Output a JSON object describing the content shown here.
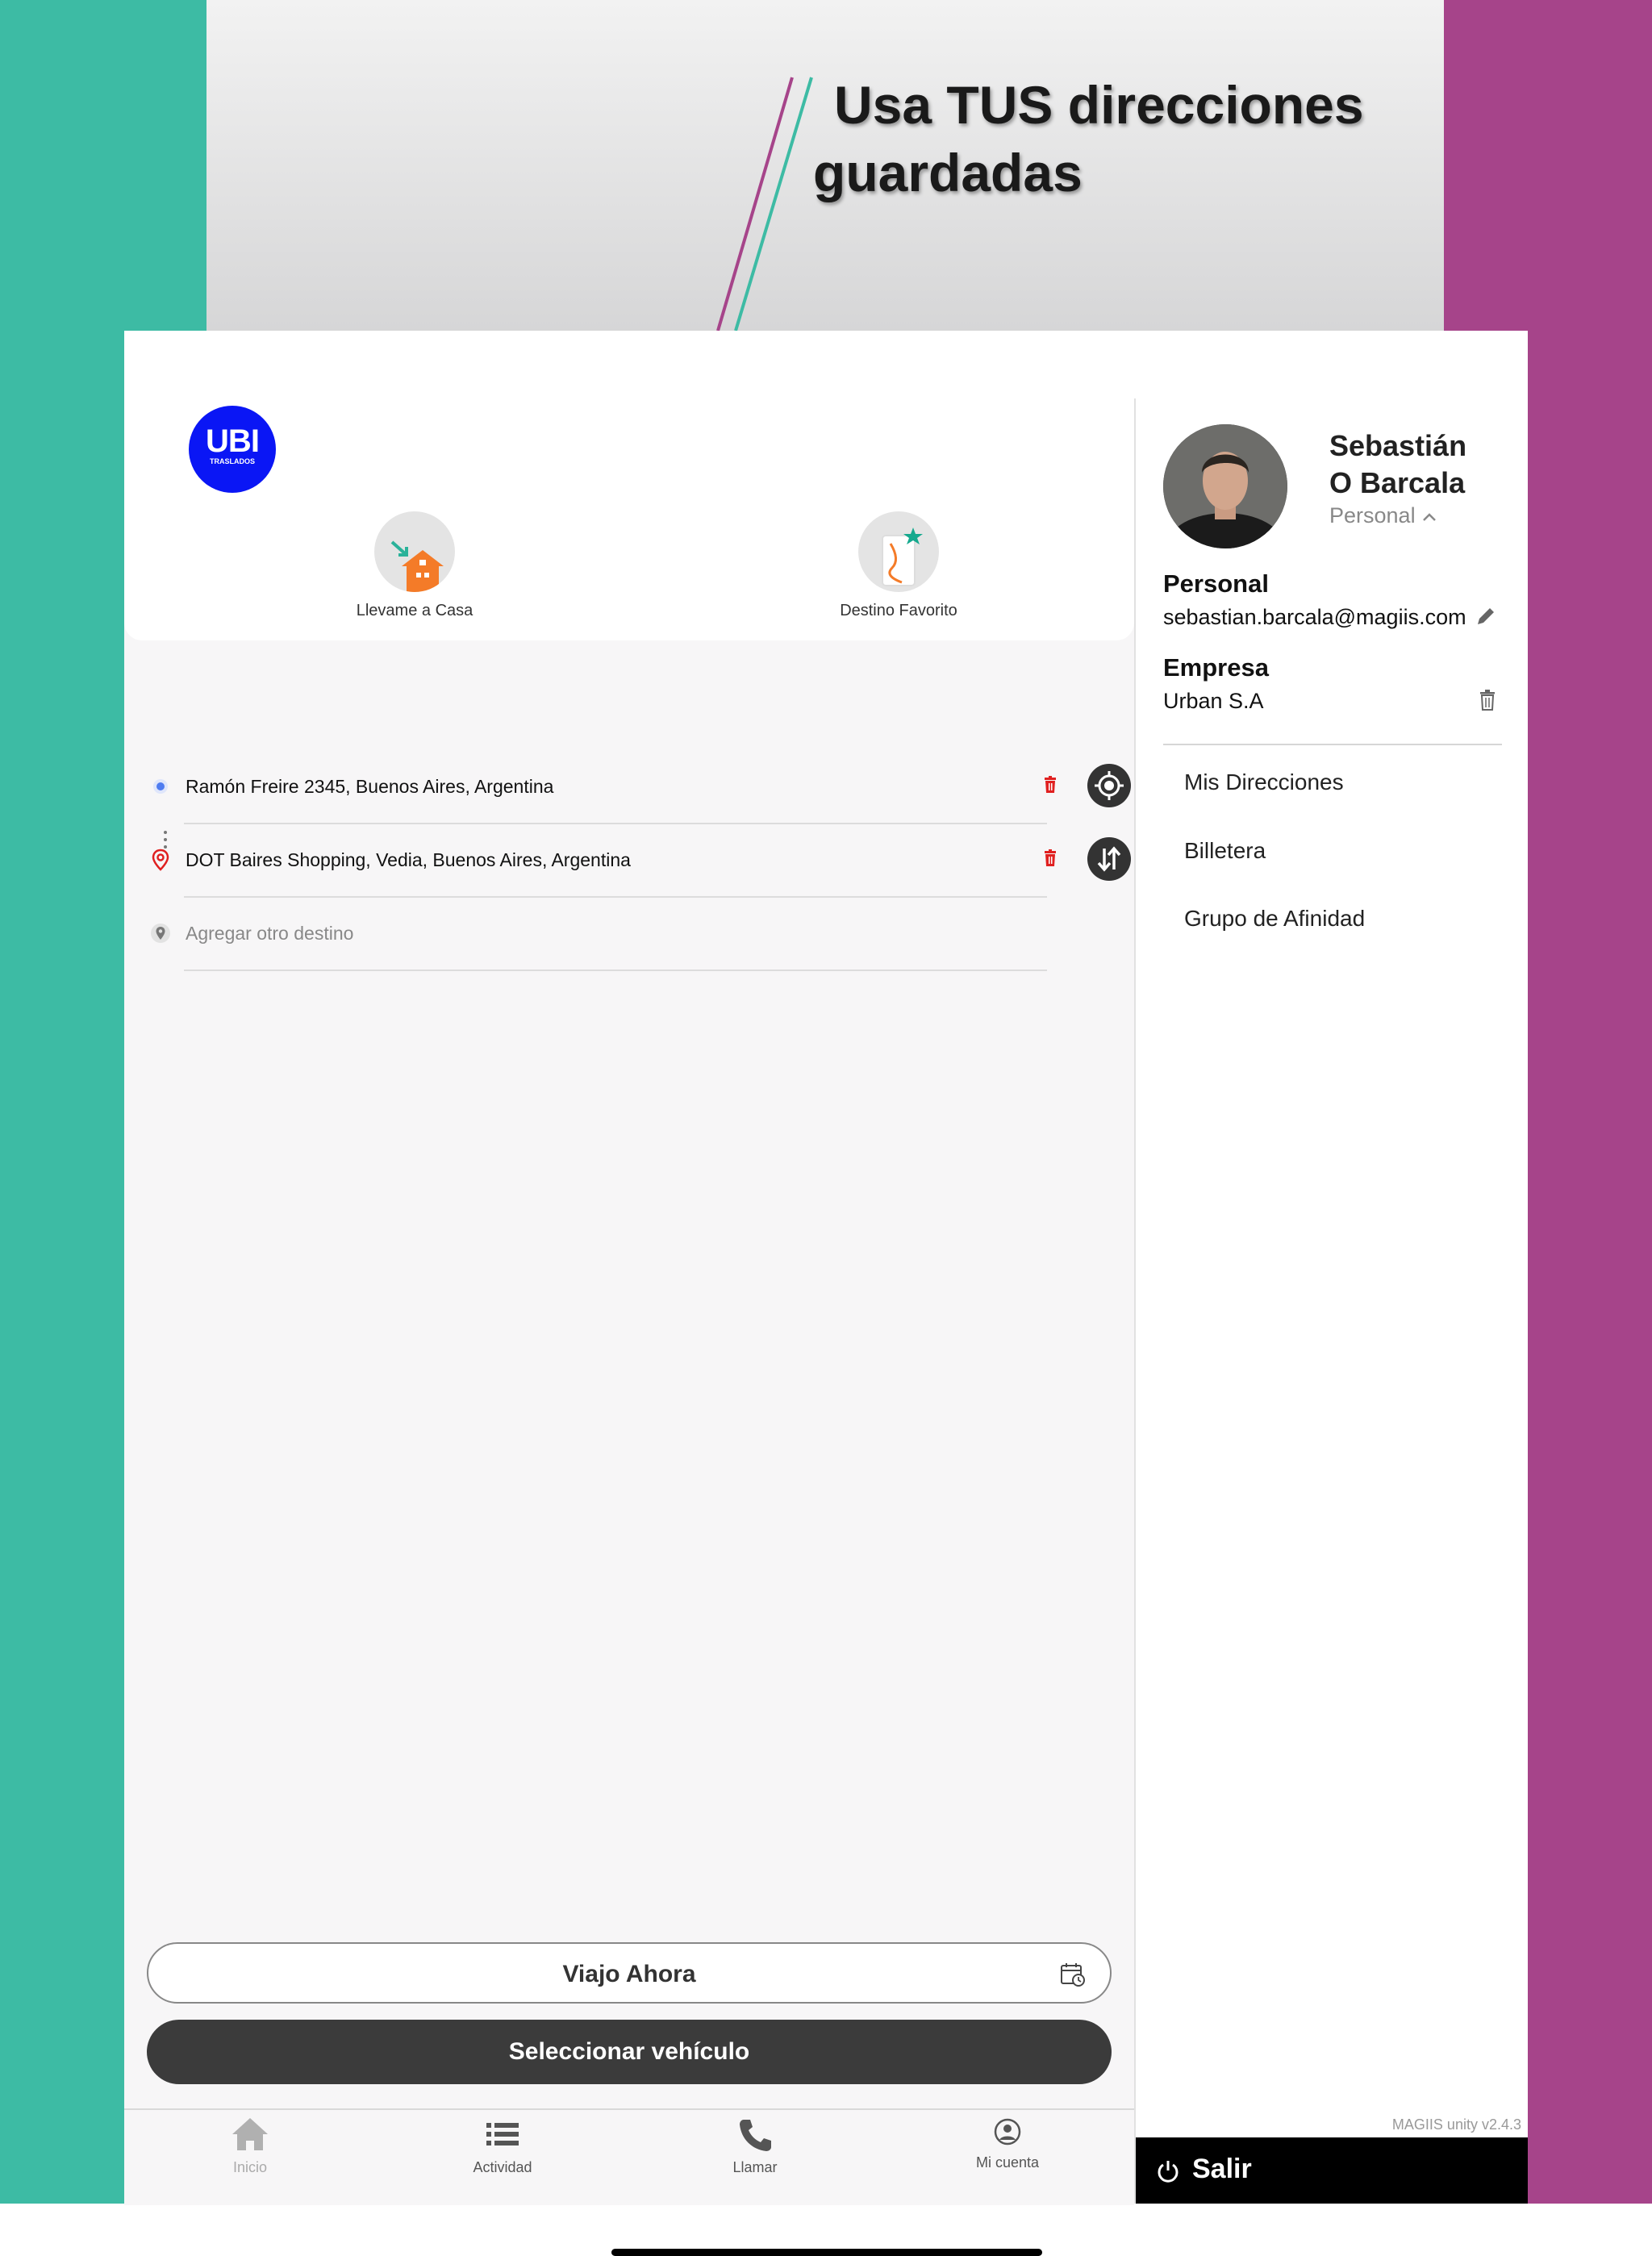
{
  "banner": {
    "headline_line1": "Usa TUS direcciones",
    "headline_line2": "guardadas"
  },
  "app": {
    "logo_main": "UBI",
    "logo_sub": "TRASLADOS"
  },
  "quick_actions": [
    {
      "label": "Llevame a Casa",
      "icon": "home-icon"
    },
    {
      "label": "Destino Favorito",
      "icon": "favorite-destination-icon"
    }
  ],
  "route": {
    "origin": "Ramón Freire 2345, Buenos Aires, Argentina",
    "destination": "DOT Baires Shopping, Vedia, Buenos Aires, Argentina",
    "add_placeholder": "Agregar otro destino"
  },
  "actions": {
    "trip_label": "Viajo Ahora",
    "select_vehicle": "Seleccionar vehículo"
  },
  "nav": [
    {
      "label": "Inicio",
      "icon": "home-icon"
    },
    {
      "label": "Actividad",
      "icon": "list-icon"
    },
    {
      "label": "Llamar",
      "icon": "phone-icon"
    },
    {
      "label": "Mi cuenta",
      "icon": "account-icon"
    }
  ],
  "profile": {
    "name_line1": "Sebastián",
    "name_line2": "O Barcala",
    "profile_type": "Personal",
    "personal_title": "Personal",
    "personal_email": "sebastian.barcala@magiis.com",
    "company_title": "Empresa",
    "company_name": "Urban S.A"
  },
  "menu": [
    "Mis Direcciones",
    "Billetera",
    "Grupo de Afinidad"
  ],
  "version": "MAGIIS unity v2.4.3",
  "logout_label": "Salir",
  "colors": {
    "teal": "#3dbba4",
    "magenta": "#a6448a",
    "logo_blue": "#0a16f5",
    "dark_button": "#3b3b3b",
    "trash_red": "#e02020"
  }
}
